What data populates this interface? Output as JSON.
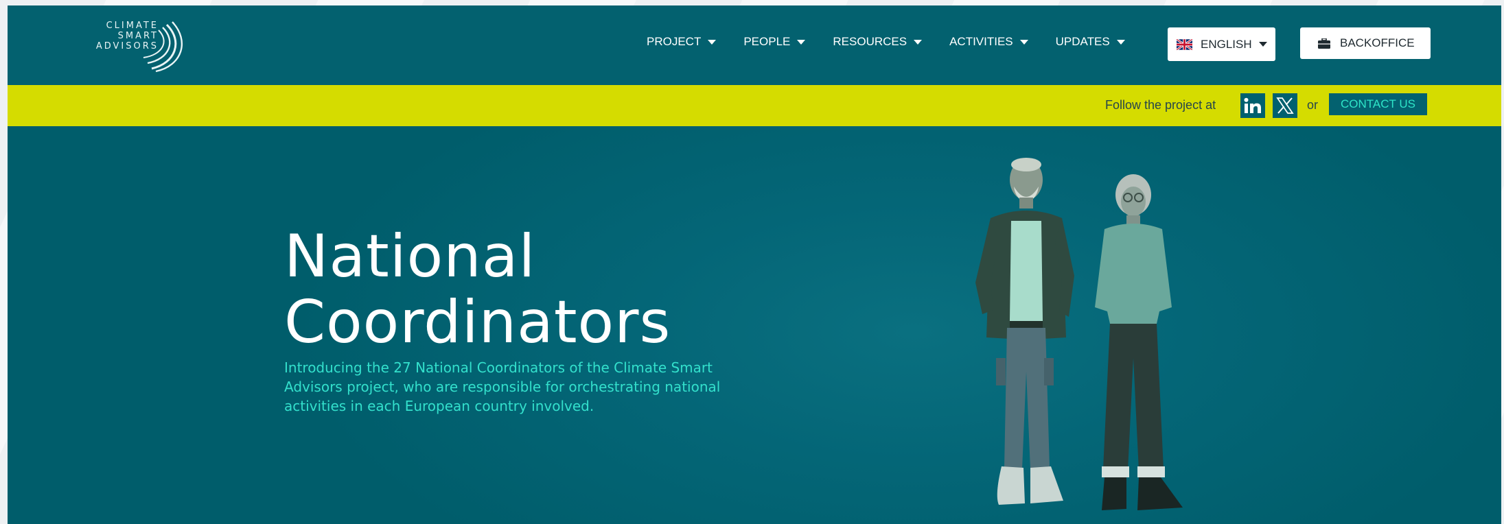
{
  "logo": {
    "lines": [
      "CLIMATE",
      "SMART",
      "ADVISORS"
    ]
  },
  "nav": {
    "items": [
      {
        "label": "PROJECT"
      },
      {
        "label": "PEOPLE"
      },
      {
        "label": "RESOURCES"
      },
      {
        "label": "ACTIVITIES"
      },
      {
        "label": "UPDATES"
      }
    ]
  },
  "language": {
    "label": "ENGLISH",
    "flag_icon": "uk-flag-icon"
  },
  "backoffice": {
    "label": "BACKOFFICE",
    "icon": "briefcase-icon"
  },
  "follow_bar": {
    "text": "Follow the project at",
    "or_text": "or",
    "contact_label": "CONTACT US",
    "social_icons": [
      "linkedin-icon",
      "x-icon"
    ]
  },
  "hero": {
    "title_line1": "National",
    "title_line2": "Coordinators",
    "subtitle": "Introducing the 27 National Coordinators of the Climate Smart Advisors project, who are responsible for orchestrating national activities in each European country involved."
  },
  "colors": {
    "header_bg": "#03616f",
    "hero_bg": "#00606f",
    "follow_bar_bg": "#d5dc00",
    "accent_text": "#33e0cc",
    "contact_text": "#2ee5c8"
  }
}
